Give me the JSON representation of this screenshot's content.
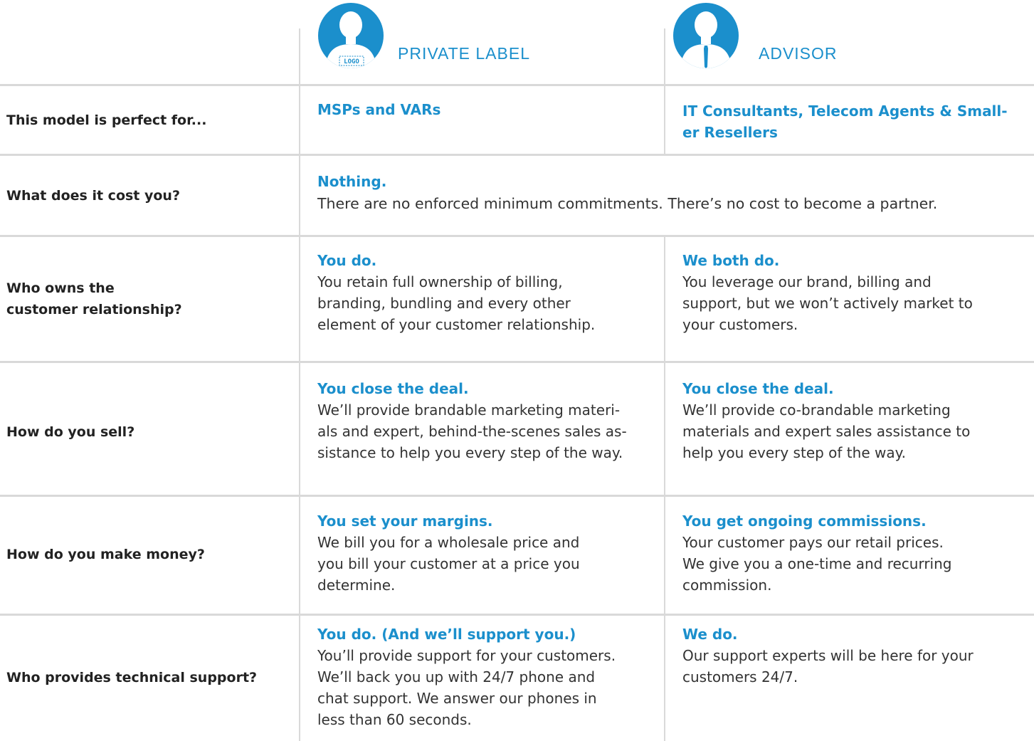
{
  "header": {
    "columns": [
      {
        "title": "PRIVATE LABEL",
        "avatar_icon": "person-with-logo-icon",
        "avatar_badge": "LOGO"
      },
      {
        "title": "ADVISOR",
        "avatar_icon": "person-with-tie-icon"
      }
    ]
  },
  "rows": [
    {
      "label": "This model is perfect for...",
      "private": {
        "headline": "MSPs and VARs",
        "body": ""
      },
      "advisor": {
        "headline": "IT Consultants, Telecom Agents & Small-\ner Resellers",
        "body": ""
      }
    },
    {
      "label": "What does it cost you?",
      "shared": {
        "headline": "Nothing.",
        "body": "There are no enforced minimum commitments. There’s no cost to become a partner."
      }
    },
    {
      "label": "Who owns the\ncustomer relationship?",
      "private": {
        "headline": "You do.",
        "body": "You retain full ownership of billing,\nbranding, bundling and every other\nelement of your customer relationship."
      },
      "advisor": {
        "headline": "We both do.",
        "body": "You leverage our brand, billing and\nsupport, but we won’t actively market to\nyour customers."
      }
    },
    {
      "label": "How do you sell?",
      "private": {
        "headline": "You close the deal.",
        "body": "We’ll provide brandable marketing materi-\nals and expert, behind-the-scenes sales as-\nsistance to help you every step of the way."
      },
      "advisor": {
        "headline": "You close the deal.",
        "body": "We’ll provide co-brandable marketing\nmaterials and expert sales assistance to\nhelp you every step of the way."
      }
    },
    {
      "label": "How do you make money?",
      "private": {
        "headline": "You set your margins.",
        "body": "We bill you for a wholesale price and\n you bill your customer at a price you\ndetermine."
      },
      "advisor": {
        "headline": "You get ongoing commissions.",
        "body": "Your customer pays our retail prices.\nWe give you a one-time and recurring\ncommission."
      }
    },
    {
      "label": "Who provides technical support?",
      "private": {
        "headline": "You do. (And we’ll support you.)",
        "body": "You’ll provide support for your customers.\nWe’ll back you up with 24/7 phone and\nchat support. We answer our phones in\nless than 60 seconds."
      },
      "advisor": {
        "headline": "We do.",
        "body": "Our support experts will be here for your\ncustomers 24/7."
      }
    }
  ],
  "colors": {
    "accent": "#1b8fcc",
    "text": "#333333",
    "divider": "#d9d9d9"
  }
}
